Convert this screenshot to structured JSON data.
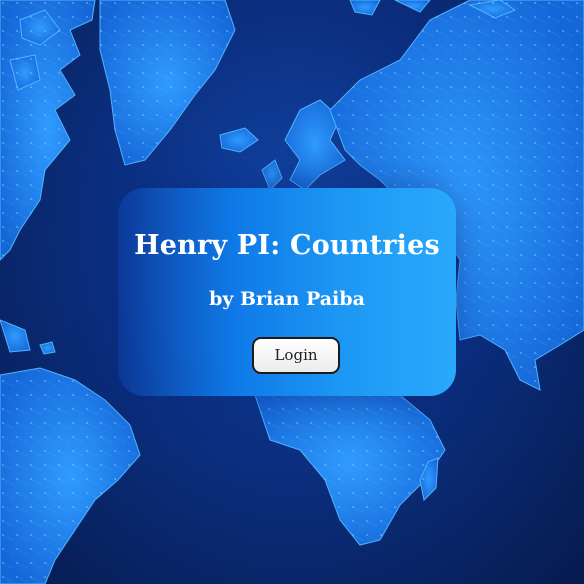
{
  "page": {
    "title": "Henry PI: Countries",
    "subtitle": "by Brian Paiba"
  },
  "actions": {
    "login_label": "Login"
  },
  "background": {
    "icon": "world-map",
    "colors": {
      "ocean_dark": "#061b4e",
      "ocean_mid": "#0b2f80",
      "land": "#1a7cf0",
      "land_highlight": "#3aa6ff"
    }
  },
  "card": {
    "colors": {
      "gradient_start": "#0f7ae8",
      "gradient_end": "#2aa8fb"
    }
  }
}
